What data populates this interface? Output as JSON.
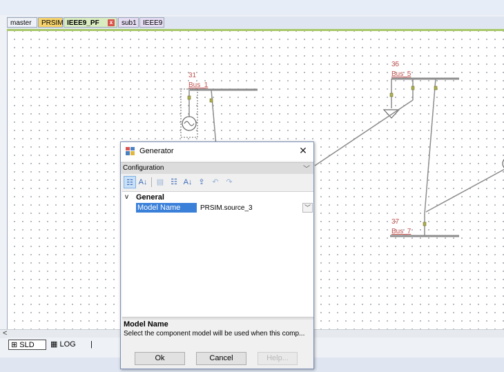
{
  "document_tabs": [
    {
      "label": "master"
    },
    {
      "label": "PRSIM"
    },
    {
      "label": "IEEE9_PF",
      "close_glyph": "x"
    },
    {
      "label": "sub1"
    },
    {
      "label": "IEEE9"
    }
  ],
  "diagram": {
    "buses": [
      {
        "number": "31",
        "name": "Bus_1"
      },
      {
        "number": "35",
        "name": "Bus_5"
      },
      {
        "number": "37",
        "name": "Bus_7"
      }
    ],
    "label_color": "#c0504d"
  },
  "scrollbar": {
    "left_arrow": "<"
  },
  "bottom_tabs": [
    {
      "label": "SLD",
      "icon": "single-line-diagram-icon"
    },
    {
      "label": "LOG",
      "icon": "log-icon"
    }
  ],
  "bottom_separator": "|",
  "dialog": {
    "title": "Generator",
    "close_glyph": "✕",
    "configuration": {
      "selected": "Configuration"
    },
    "toolbar": [
      {
        "icon": "categorized-icon",
        "glyph": "☷",
        "active": true
      },
      {
        "icon": "sort-alpha-icon",
        "glyph": "A↓"
      },
      {
        "icon": "property-pages-icon",
        "glyph": "▤"
      },
      {
        "icon": "expand-all-icon",
        "glyph": "☷"
      },
      {
        "icon": "sort-az-icon",
        "glyph": "A↓"
      },
      {
        "icon": "export-icon",
        "glyph": "⇪"
      },
      {
        "icon": "undo-icon",
        "glyph": "↶"
      },
      {
        "icon": "redo-icon",
        "glyph": "↷"
      }
    ],
    "grid": {
      "category": "General",
      "category_glyph": "v",
      "property_name": "Model Name",
      "property_value": "PRSIM.source_3"
    },
    "description": {
      "title": "Model Name",
      "text": "Select the component model will be used when this comp..."
    },
    "buttons": {
      "ok": "Ok",
      "cancel": "Cancel",
      "help": "Help..."
    }
  }
}
